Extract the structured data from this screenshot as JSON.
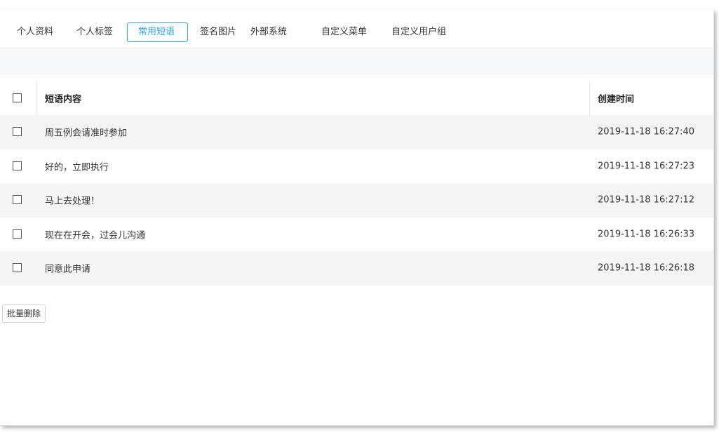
{
  "tabs": [
    {
      "label": "个人资料",
      "active": false
    },
    {
      "label": "个人标签",
      "active": false
    },
    {
      "label": "常用短语",
      "active": true
    },
    {
      "label": "签名图片",
      "active": false
    },
    {
      "label": "外部系统",
      "active": false
    },
    {
      "label": "自定义菜单",
      "active": false
    },
    {
      "label": "自定义用户组",
      "active": false
    }
  ],
  "table": {
    "columns": {
      "content": "短语内容",
      "created": "创建时间"
    },
    "rows": [
      {
        "content": "周五例会请准时参加",
        "created": "2019-11-18 16:27:40"
      },
      {
        "content": "好的，立即执行",
        "created": "2019-11-18 16:27:23"
      },
      {
        "content": "马上去处理！",
        "created": "2019-11-18 16:27:12"
      },
      {
        "content": "现在在开会，过会儿沟通",
        "created": "2019-11-18 16:26:33"
      },
      {
        "content": "同意此申请",
        "created": "2019-11-18 16:26:18"
      }
    ]
  },
  "actions": {
    "batch_delete": "批量删除"
  },
  "colors": {
    "accent": "#2aa6e0",
    "row_alt": "#f5f5f5"
  }
}
